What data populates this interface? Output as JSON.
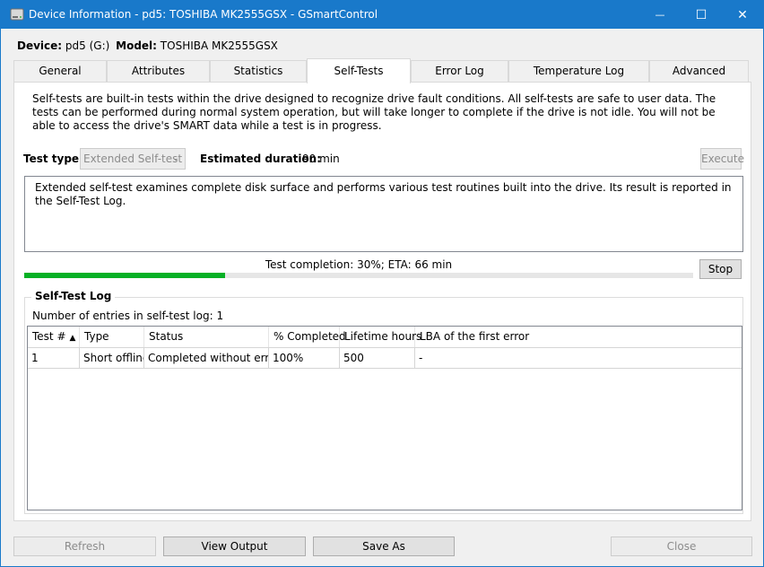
{
  "window": {
    "title": "Device Information - pd5: TOSHIBA MK2555GSX - GSmartControl",
    "min_glyph": "—",
    "max_glyph": "☐",
    "close_glyph": "✕"
  },
  "device": {
    "device_label": "Device:",
    "device_value": "pd5 (G:)",
    "model_label": "Model:",
    "model_value": "TOSHIBA MK2555GSX"
  },
  "tabs": [
    {
      "label": "General"
    },
    {
      "label": "Attributes"
    },
    {
      "label": "Statistics"
    },
    {
      "label": "Self-Tests"
    },
    {
      "label": "Error Log"
    },
    {
      "label": "Temperature Log"
    },
    {
      "label": "Advanced"
    }
  ],
  "selftests": {
    "intro": "Self-tests are built-in tests within the drive designed to recognize drive fault conditions. All self-tests are safe to user data. The tests can be performed during normal system operation, but will take longer to complete if the drive is not idle. You will not be able to access the drive's SMART data while a test is in progress.",
    "test_type_label": "Test type:",
    "test_type_value": "Extended Self-test",
    "duration_label": "Estimated duration:",
    "duration_value": "90 min",
    "execute_label": "Execute",
    "description": "Extended self-test examines complete disk surface and performs various test routines built into the drive. Its result is reported in the Self-Test Log.",
    "progress_text": "Test completion: 30%; ETA: 66 min",
    "progress_fraction": 0.3,
    "stop_label": "Stop"
  },
  "log": {
    "title": "Self-Test Log",
    "entries_text": "Number of entries in self-test log: 1",
    "columns": [
      "Test #",
      "Type",
      "Status",
      "% Completed",
      "Lifetime hours",
      "LBA of the first error"
    ],
    "rows": [
      [
        "1",
        "Short offline",
        "Completed without error",
        "100%",
        "500",
        "-"
      ]
    ]
  },
  "footer": {
    "refresh": "Refresh",
    "view_output": "View Output",
    "save_as": "Save As",
    "close": "Close"
  },
  "colors": {
    "titlebar": "#1979ca",
    "progress_fill": "#06b025"
  },
  "icons": {
    "app": "disk-drive-icon",
    "sort": "sort-ascending-icon"
  }
}
